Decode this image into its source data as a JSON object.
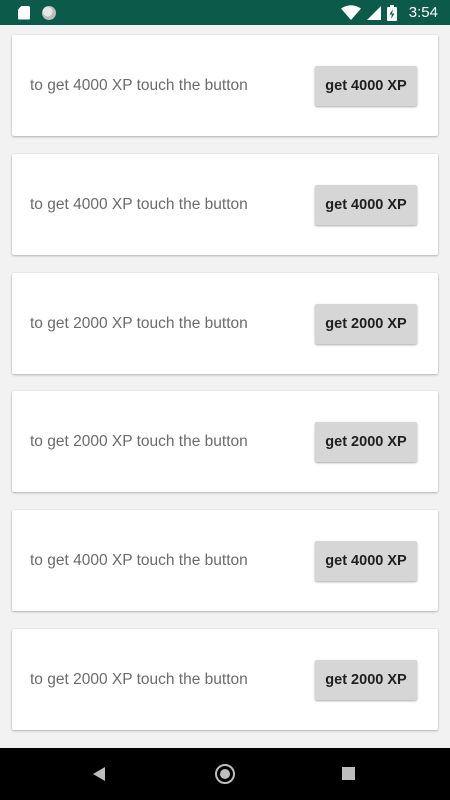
{
  "status_bar": {
    "time": "3:54",
    "icons": [
      "sd-card-icon",
      "sync-circle-icon",
      "wifi-icon",
      "signal-icon",
      "battery-charging-icon"
    ],
    "background": "#0b5a4a"
  },
  "cards": [
    {
      "text": "to get 4000 XP touch the button",
      "button": "get 4000 XP"
    },
    {
      "text": "to get 4000 XP touch the button",
      "button": "get 4000 XP"
    },
    {
      "text": "to get 2000 XP touch the button",
      "button": "get 2000 XP"
    },
    {
      "text": "to get 2000 XP touch the button",
      "button": "get 2000 XP"
    },
    {
      "text": "to get 4000 XP touch the button",
      "button": "get 4000 XP"
    },
    {
      "text": "to get 2000 XP touch the button",
      "button": "get 2000 XP"
    }
  ],
  "nav_bar": {
    "icons": [
      "back-icon",
      "home-icon",
      "recent-apps-icon"
    ]
  }
}
